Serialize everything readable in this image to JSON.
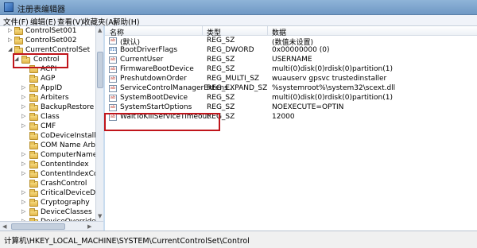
{
  "window": {
    "title": "注册表编辑器"
  },
  "menu": [
    "文件(F)",
    "编辑(E)",
    "查看(V)",
    "收藏夹(A)",
    "帮助(H)"
  ],
  "tree": [
    {
      "label": "ControlSet001",
      "arrow": "▷"
    },
    {
      "label": "ControlSet002",
      "arrow": "▷"
    },
    {
      "label": "CurrentControlSet",
      "arrow": "◢"
    },
    {
      "label": "Control",
      "arrow": "◢"
    },
    {
      "label": "ACPI",
      "arrow": ""
    },
    {
      "label": "AGP",
      "arrow": ""
    },
    {
      "label": "AppID",
      "arrow": "▷"
    },
    {
      "label": "Arbiters",
      "arrow": "▷"
    },
    {
      "label": "BackupRestore",
      "arrow": "▷"
    },
    {
      "label": "Class",
      "arrow": "▷"
    },
    {
      "label": "CMF",
      "arrow": "▷"
    },
    {
      "label": "CoDeviceInstallers",
      "arrow": ""
    },
    {
      "label": "COM Name Arbiter",
      "arrow": ""
    },
    {
      "label": "ComputerName",
      "arrow": "▷"
    },
    {
      "label": "ContentIndex",
      "arrow": "▷"
    },
    {
      "label": "ContentIndexComm",
      "arrow": "▷"
    },
    {
      "label": "CrashControl",
      "arrow": ""
    },
    {
      "label": "CriticalDeviceDataba",
      "arrow": "▷"
    },
    {
      "label": "Cryptography",
      "arrow": "▷"
    },
    {
      "label": "DeviceClasses",
      "arrow": "▷"
    },
    {
      "label": "DeviceOverrides",
      "arrow": "▷"
    }
  ],
  "columns": {
    "name": "名称",
    "type": "类型",
    "data": "数据"
  },
  "values": [
    {
      "name": "(默认)",
      "type": "REG_SZ",
      "data": "(数值未设置)",
      "icon": "ab"
    },
    {
      "name": "BootDriverFlags",
      "type": "REG_DWORD",
      "data": "0x00000000 (0)",
      "icon": "010"
    },
    {
      "name": "CurrentUser",
      "type": "REG_SZ",
      "data": "USERNAME",
      "icon": "ab"
    },
    {
      "name": "FirmwareBootDevice",
      "type": "REG_SZ",
      "data": "multi(0)disk(0)rdisk(0)partition(1)",
      "icon": "ab"
    },
    {
      "name": "PreshutdownOrder",
      "type": "REG_MULTI_SZ",
      "data": "wuauserv gpsvc trustedinstaller",
      "icon": "ab"
    },
    {
      "name": "ServiceControlManagerExtens...",
      "type": "REG_EXPAND_SZ",
      "data": "%systemroot%\\system32\\scext.dll",
      "icon": "ab"
    },
    {
      "name": "SystemBootDevice",
      "type": "REG_SZ",
      "data": "multi(0)disk(0)rdisk(0)partition(1)",
      "icon": "ab"
    },
    {
      "name": "SystemStartOptions",
      "type": "REG_SZ",
      "data": " NOEXECUTE=OPTIN",
      "icon": "ab"
    },
    {
      "name": "WaitToKillServiceTimeout",
      "type": "REG_SZ",
      "data": "12000",
      "icon": "ab"
    }
  ],
  "status": "计算机\\HKEY_LOCAL_MACHINE\\SYSTEM\\CurrentControlSet\\Control",
  "colors": {
    "highlight": "#c0151b",
    "titlebar": "#7aa2cc"
  }
}
